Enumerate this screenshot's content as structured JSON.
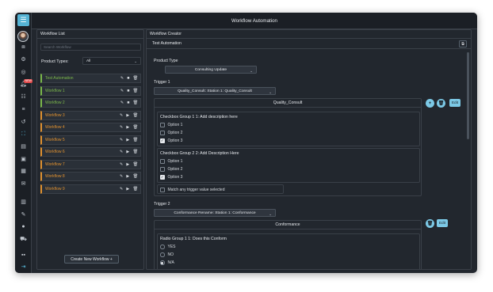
{
  "window": {
    "title": "Workflow Automation"
  },
  "left_panel": {
    "header": "Workflow List",
    "search_placeholder": "Search Workflow",
    "product_types_label": "Product Types:",
    "product_types_value": "All",
    "workflows": [
      {
        "name": "Test Automation",
        "status": "green",
        "actions": [
          "edit-icon",
          "stop-icon",
          "delete-icon"
        ]
      },
      {
        "name": "Workflow 1",
        "status": "green",
        "actions": [
          "edit-icon",
          "stop-icon",
          "delete-icon"
        ]
      },
      {
        "name": "Workflow 2",
        "status": "green",
        "actions": [
          "edit-icon",
          "stop-icon",
          "delete-icon"
        ]
      },
      {
        "name": "Workflow 3",
        "status": "orange",
        "actions": [
          "edit-icon",
          "play-icon",
          "delete-icon"
        ]
      },
      {
        "name": "Workflow 4",
        "status": "orange",
        "actions": [
          "edit-icon",
          "play-icon",
          "delete-icon"
        ]
      },
      {
        "name": "Workflow 5",
        "status": "orange",
        "actions": [
          "edit-icon",
          "play-icon",
          "delete-icon"
        ]
      },
      {
        "name": "Workflow 6",
        "status": "orange",
        "actions": [
          "edit-icon",
          "play-icon",
          "delete-icon"
        ]
      },
      {
        "name": "Workflow 7",
        "status": "orange",
        "actions": [
          "edit-icon",
          "play-icon",
          "delete-icon"
        ]
      },
      {
        "name": "Workflow 8",
        "status": "orange",
        "actions": [
          "edit-icon",
          "play-icon",
          "delete-icon"
        ]
      },
      {
        "name": "Workflow 9",
        "status": "orange",
        "actions": [
          "edit-icon",
          "play-icon",
          "delete-icon"
        ]
      }
    ],
    "create_button": "Create New Workflow +"
  },
  "right_panel": {
    "header": "Workflow Creator",
    "workflow_name": "Test Automation",
    "product_type_label": "Product Type",
    "product_type_value": "Consulting Update",
    "trigger1": {
      "label": "Trigger 1",
      "value": "Quality_Consult: Station 1: Quality_Consult",
      "section_title": "Quality_Consult",
      "edit_label": "Edit",
      "group1": {
        "title": "Checkbox Group 1 1: Add description here",
        "options": [
          {
            "label": "Option 1",
            "checked": false
          },
          {
            "label": "Option 2",
            "checked": false
          },
          {
            "label": "Option 3",
            "checked": true
          }
        ]
      },
      "group2": {
        "title": "Checkbox Group 2 2: Add Description Here",
        "options": [
          {
            "label": "Option 1",
            "checked": false
          },
          {
            "label": "Option 2",
            "checked": false
          },
          {
            "label": "Option 3",
            "checked": true
          }
        ]
      },
      "match_any_label": "Match any trigger value selected"
    },
    "trigger2": {
      "label": "Trigger 2",
      "value": "Conformance Rename: Station 1: Conformance",
      "section_title": "Conformance",
      "edit_label": "Edit",
      "radio_group": {
        "title": "Radio Group 1 1: Does this Conform",
        "options": [
          {
            "label": "YES",
            "selected": false
          },
          {
            "label": "NO",
            "selected": false
          },
          {
            "label": "N/A",
            "selected": true
          }
        ]
      }
    }
  },
  "colors": {
    "accent": "#55b3d4",
    "active_green": "#7bb84a",
    "inactive_orange": "#e0912f",
    "button_cyan": "#7cc9e6"
  },
  "nav_icons": [
    "box-icon",
    "settings-icon",
    "target-icon",
    "alert-icon",
    "list-icon",
    "menu-icon",
    "history-icon",
    "workflow-icon",
    "document-icon",
    "image-icon",
    "calendar-icon",
    "mail-icon",
    "chart-icon",
    "tools-icon",
    "user-icon",
    "truck-icon",
    "grid-icon",
    "logout-icon"
  ],
  "alert_badge": "NEW"
}
